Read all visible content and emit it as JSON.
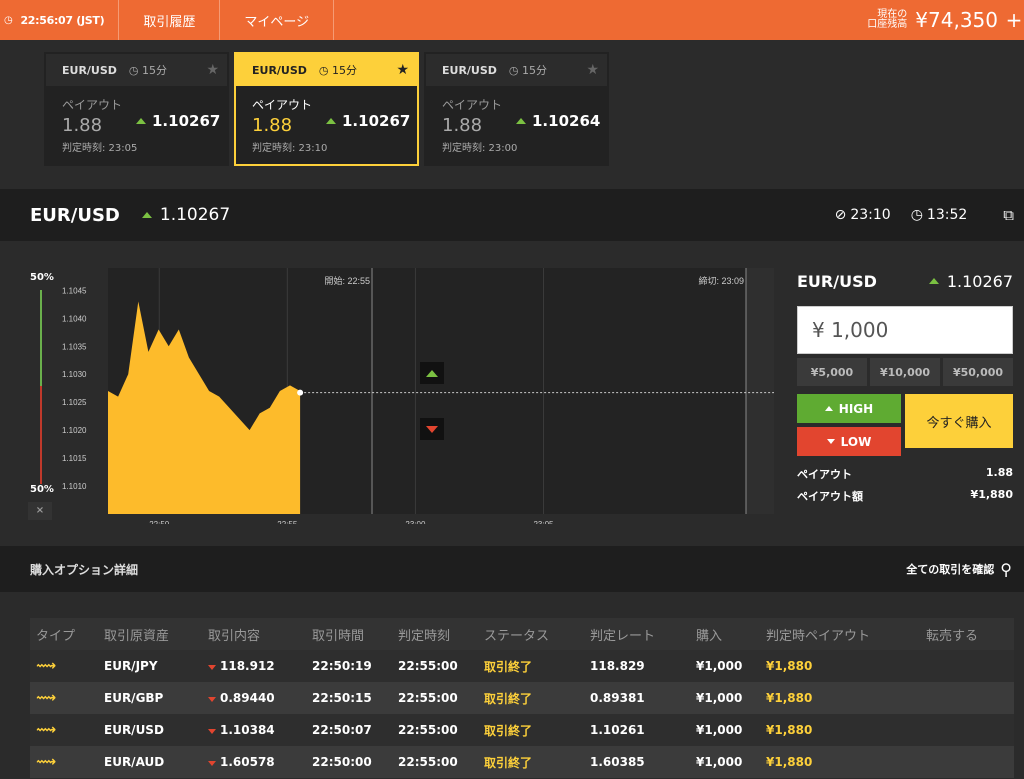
{
  "topbar": {
    "time": "22:56:07 (JST)",
    "nav": [
      "取引履歴",
      "マイページ"
    ],
    "balance_label_1": "現在の",
    "balance_label_2": "口座残高",
    "balance": "¥74,350",
    "plus": "+"
  },
  "cards": [
    {
      "pair": "EUR/USD",
      "duration": "15分",
      "payout_label": "ペイアウト",
      "payout": "1.88",
      "rate": "1.10267",
      "time": "判定時刻: 23:05"
    },
    {
      "pair": "EUR/USD",
      "duration": "15分",
      "payout_label": "ペイアウト",
      "payout": "1.88",
      "rate": "1.10267",
      "time": "判定時刻: 23:10"
    },
    {
      "pair": "EUR/USD",
      "duration": "15分",
      "payout_label": "ペイアウト",
      "payout": "1.88",
      "rate": "1.10264",
      "time": "判定時刻: 23:00"
    }
  ],
  "asset": {
    "pair": "EUR/USD",
    "rate": "1.10267",
    "close_time": "23:10",
    "remaining": "13:52"
  },
  "chart_data": {
    "type": "area",
    "y_ticks": [
      "1.1045",
      "1.1040",
      "1.1035",
      "1.1030",
      "1.1025",
      "1.1020",
      "1.1015",
      "1.1010"
    ],
    "x_ticks": [
      "22:50",
      "22:55",
      "23:00",
      "23:05"
    ],
    "start_label": "開始: 22:55",
    "end_label": "締切: 23:09",
    "ylim": [
      1.1005,
      1.1049
    ],
    "current": 1.10267,
    "x": [
      22.8,
      22.81,
      22.82,
      22.83,
      22.84,
      22.85,
      22.86,
      22.87,
      22.88,
      22.89,
      22.9,
      22.91,
      22.92,
      22.93,
      22.94,
      22.95,
      22.96,
      22.97,
      22.98,
      22.99
    ],
    "values": [
      1.1027,
      1.1026,
      1.103,
      1.1043,
      1.1034,
      1.1038,
      1.1035,
      1.1038,
      1.1033,
      1.103,
      1.1027,
      1.1026,
      1.1024,
      1.1022,
      1.102,
      1.1023,
      1.1024,
      1.1027,
      1.1028,
      1.1027
    ],
    "meter_top": "50%",
    "meter_bottom": "50%",
    "meter_close": "×"
  },
  "panel": {
    "pair": "EUR/USD",
    "rate": "1.10267",
    "amount": "¥ 1,000",
    "quick": [
      "¥5,000",
      "¥10,000",
      "¥50,000"
    ],
    "high": "HIGH",
    "low": "LOW",
    "buy_now": "今すぐ購入",
    "payout_label": "ペイアウト",
    "payout": "1.88",
    "payout_amount_label": "ペイアウト額",
    "payout_amount": "¥1,880"
  },
  "details": {
    "title": "購入オプション詳細",
    "view_all": "全ての取引を確認",
    "headers": [
      "タイプ",
      "取引原資産",
      "取引内容",
      "取引時間",
      "判定時刻",
      "ステータス",
      "判定レート",
      "購入",
      "判定時ペイアウト",
      "転売する"
    ],
    "rows": [
      {
        "asset": "EUR/JPY",
        "entry": "118.912",
        "time": "22:50:19",
        "expiry": "22:55:00",
        "status": "取引終了",
        "rate": "118.829",
        "purchase": "¥1,000",
        "payout": "¥1,880"
      },
      {
        "asset": "EUR/GBP",
        "entry": "0.89440",
        "time": "22:50:15",
        "expiry": "22:55:00",
        "status": "取引終了",
        "rate": "0.89381",
        "purchase": "¥1,000",
        "payout": "¥1,880"
      },
      {
        "asset": "EUR/USD",
        "entry": "1.10384",
        "time": "22:50:07",
        "expiry": "22:55:00",
        "status": "取引終了",
        "rate": "1.10261",
        "purchase": "¥1,000",
        "payout": "¥1,880"
      },
      {
        "asset": "EUR/AUD",
        "entry": "1.60578",
        "time": "22:50:00",
        "expiry": "22:55:00",
        "status": "取引終了",
        "rate": "1.60385",
        "purchase": "¥1,000",
        "payout": "¥1,880"
      }
    ]
  },
  "colors": {
    "accent": "#ee6a33",
    "yellow": "#fdd03a",
    "green": "#5fab32",
    "red": "#e2452f"
  }
}
